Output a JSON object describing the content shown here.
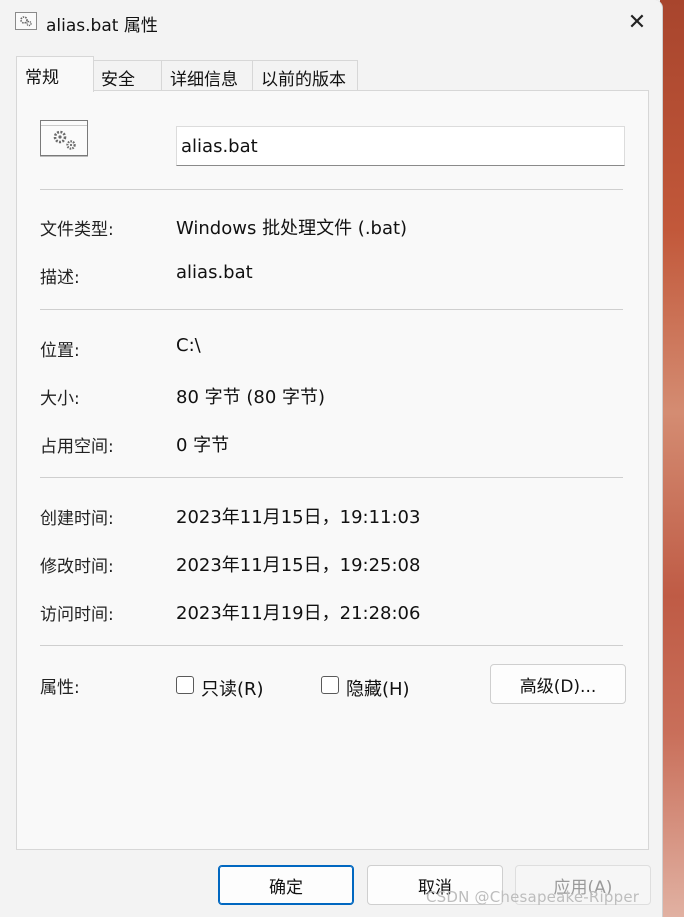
{
  "window": {
    "title": "alias.bat 属性",
    "close_glyph": "✕"
  },
  "tabs": [
    {
      "label": "常规",
      "active": true
    },
    {
      "label": "安全",
      "active": false
    },
    {
      "label": "详细信息",
      "active": false
    },
    {
      "label": "以前的版本",
      "active": false
    }
  ],
  "general": {
    "file_name": "alias.bat",
    "file_type_label": "文件类型:",
    "file_type_value": "Windows 批处理文件 (.bat)",
    "description_label": "描述:",
    "description_value": "alias.bat",
    "location_label": "位置:",
    "location_value": "C:\\",
    "size_label": "大小:",
    "size_value": "80 字节 (80 字节)",
    "size_on_disk_label": "占用空间:",
    "size_on_disk_value": "0 字节",
    "created_label": "创建时间:",
    "created_value": "2023年11月15日，19:11:03",
    "modified_label": "修改时间:",
    "modified_value": "2023年11月15日，19:25:08",
    "accessed_label": "访问时间:",
    "accessed_value": "2023年11月19日，21:28:06",
    "attributes_label": "属性:",
    "readonly_label": "只读(R)",
    "hidden_label": "隐藏(H)",
    "advanced_label": "高级(D)..."
  },
  "footer": {
    "ok_label": "确定",
    "cancel_label": "取消",
    "apply_label": "应用(A)"
  },
  "watermark": "CSDN @Chesapeake-Ripper",
  "icons": {
    "title": "batch-file-gear-icon",
    "file": "batch-file-gear-icon"
  },
  "colors": {
    "accent": "#0067c0",
    "window_bg": "#f3f3f3",
    "panel_bg": "#f9f9f9"
  }
}
